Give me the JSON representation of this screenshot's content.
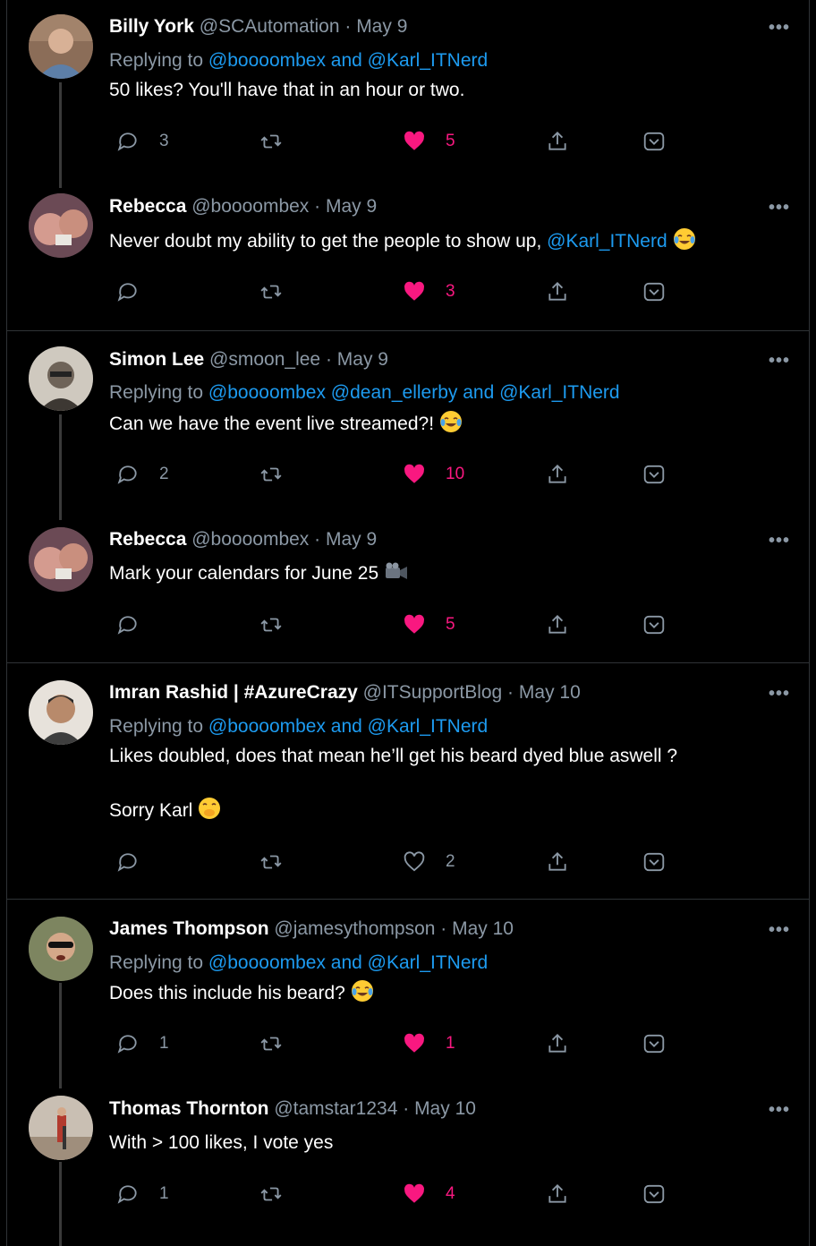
{
  "tweets": [
    {
      "name": "Billy York",
      "handle": "@SCAutomation",
      "date": "May 9",
      "replying_prefix": "Replying to",
      "replying_to": "@boooombex and @Karl_ITNerd",
      "lines": [
        "50 likes? You'll have that in an hour or two."
      ],
      "replies": "3",
      "likes": "5",
      "liked": true,
      "avatar_color": "#7a6a5c"
    },
    {
      "name": "Rebecca",
      "handle": "@boooombex",
      "date": "May 9",
      "text_before": "Never doubt my ability to get the people to show up, ",
      "mention": "@Karl_ITNerd",
      "emoji": "laughing-crying-emoji",
      "replies": "",
      "likes": "3",
      "liked": true,
      "avatar_color": "#8a5b66"
    },
    {
      "name": "Simon Lee",
      "handle": "@smoon_lee",
      "date": "May 9",
      "replying_prefix": "Replying to",
      "replying_to": "@boooombex @dean_ellerby and @Karl_ITNerd",
      "text_before": "Can we have the event live streamed?! ",
      "emoji": "laughing-crying-emoji",
      "replies": "2",
      "likes": "10",
      "liked": true,
      "avatar_color": "#9a9488"
    },
    {
      "name": "Rebecca",
      "handle": "@boooombex",
      "date": "May 9",
      "text_before": "Mark your calendars for June 25 ",
      "emoji": "video-camera-emoji",
      "replies": "",
      "likes": "5",
      "liked": true,
      "avatar_color": "#8a5b66"
    },
    {
      "name": "Imran Rashid | #AzureCrazy",
      "handle": "@ITSupportBlog",
      "date": "May 10",
      "replying_prefix": "Replying to",
      "replying_to": "@boooombex and @Karl_ITNerd",
      "lines": [
        "Likes doubled, does that mean he’ll get his beard dyed blue aswell ?"
      ],
      "line2": "Sorry Karl ",
      "emoji": "hand-over-mouth-emoji",
      "replies": "",
      "likes": "2",
      "liked": false,
      "avatar_color": "#c9c0b6"
    },
    {
      "name": "James Thompson",
      "handle": "@jamesythompson",
      "date": "May 10",
      "replying_prefix": "Replying to",
      "replying_to": "@boooombex and @Karl_ITNerd",
      "text_before": "Does this include his beard? ",
      "emoji": "laughing-crying-emoji",
      "replies": "1",
      "likes": "1",
      "liked": true,
      "avatar_color": "#6d7358"
    },
    {
      "name": "Thomas Thornton",
      "handle": "@tamstar1234",
      "date": "May 10",
      "lines": [
        "With > 100 likes, I vote yes"
      ],
      "replies": "1",
      "likes": "4",
      "liked": true,
      "avatar_color": "#b7aca0"
    }
  ],
  "ui": {
    "more": "•••",
    "dot": " · "
  },
  "colors": {
    "like": "#f91880",
    "link": "#1d9bf0",
    "muted": "#8b98a5"
  }
}
